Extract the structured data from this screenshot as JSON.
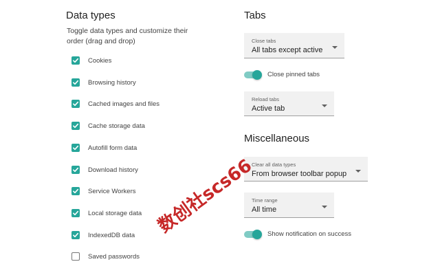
{
  "data_types": {
    "title": "Data types",
    "description": "Toggle data types and customize their order (drag and drop)",
    "items": [
      {
        "label": "Cookies",
        "checked": true
      },
      {
        "label": "Browsing history",
        "checked": true
      },
      {
        "label": "Cached images and files",
        "checked": true
      },
      {
        "label": "Cache storage data",
        "checked": true
      },
      {
        "label": "Autofill form data",
        "checked": true
      },
      {
        "label": "Download history",
        "checked": true
      },
      {
        "label": "Service Workers",
        "checked": true
      },
      {
        "label": "Local storage data",
        "checked": true
      },
      {
        "label": "IndexedDB data",
        "checked": true
      },
      {
        "label": "Saved passwords",
        "checked": false
      }
    ]
  },
  "tabs": {
    "title": "Tabs",
    "close_tabs": {
      "label": "Close tabs",
      "value": "All tabs except active"
    },
    "close_pinned": {
      "label": "Close pinned tabs",
      "on": true
    },
    "reload_tabs": {
      "label": "Reload tabs",
      "value": "Active tab"
    }
  },
  "misc": {
    "title": "Miscellaneous",
    "clear_all": {
      "label": "Clear all data types",
      "value": "From browser toolbar popup"
    },
    "time_range": {
      "label": "Time range",
      "value": "All time"
    },
    "show_notification": {
      "label": "Show notification on success",
      "on": true
    }
  },
  "watermark": "数创社scs66",
  "colors": {
    "accent": "#26a69a",
    "accent_light": "#80cbc4",
    "select_bg": "#f1f1f1",
    "watermark": "#c62828"
  }
}
